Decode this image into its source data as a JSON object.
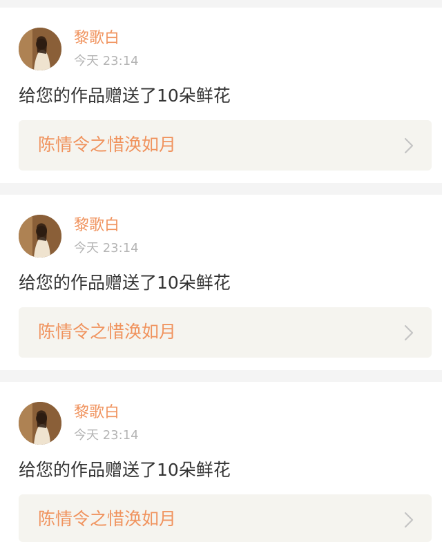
{
  "notifications": [
    {
      "username": "黎歌白",
      "time": "今天 23:14",
      "message": "给您的作品赠送了10朵鲜花",
      "work_title": "陈情令之惜涣如月"
    },
    {
      "username": "黎歌白",
      "time": "今天 23:14",
      "message": "给您的作品赠送了10朵鲜花",
      "work_title": "陈情令之惜涣如月"
    },
    {
      "username": "黎歌白",
      "time": "今天 23:14",
      "message": "给您的作品赠送了10朵鲜花",
      "work_title": "陈情令之惜涣如月"
    }
  ],
  "icons": {
    "avatar": "user-avatar-photo",
    "link_arrow": "chevron-right-icon"
  },
  "colors": {
    "accent": "#f0935e",
    "timestamp": "#b4b4b4",
    "message_text": "#333333",
    "link_background": "#f5f4ef",
    "page_background": "#f4f4f4"
  }
}
